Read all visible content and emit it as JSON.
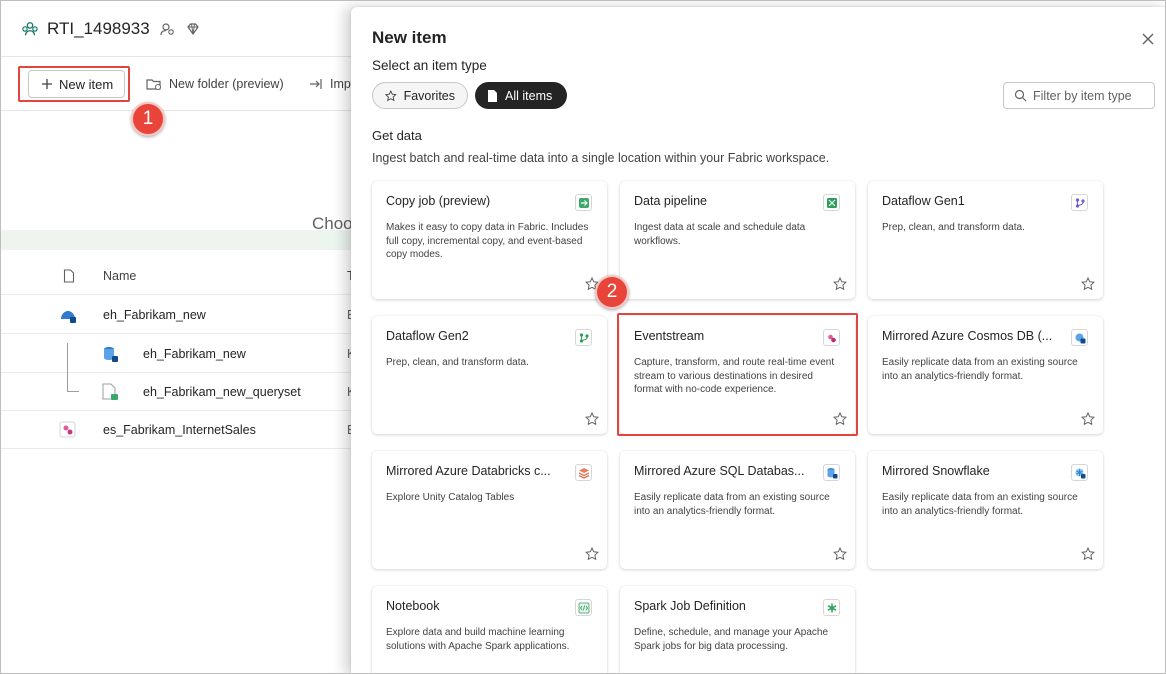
{
  "workspace": {
    "title": "RTI_1498933",
    "toolbar": {
      "new_item": "New item",
      "new_folder": "New folder (preview)",
      "import": "Imp"
    },
    "choose_text": "Choo",
    "table": {
      "col_name": "Name",
      "col_type": "T",
      "rows": [
        {
          "name": "eh_Fabrikam_new",
          "type": "E"
        },
        {
          "name": "eh_Fabrikam_new",
          "type": "K"
        },
        {
          "name": "eh_Fabrikam_new_queryset",
          "type": "K"
        },
        {
          "name": "es_Fabrikam_InternetSales",
          "type": "E"
        }
      ]
    }
  },
  "callouts": {
    "one": "1",
    "two": "2"
  },
  "panel": {
    "title": "New item",
    "subtitle": "Select an item type",
    "pill_favorites": "Favorites",
    "pill_all": "All items",
    "filter_placeholder": "Filter by item type",
    "section_title": "Get data",
    "section_desc": "Ingest batch and real-time data into a single location within your Fabric workspace.",
    "cards": [
      {
        "title": "Copy job (preview)",
        "desc": "Makes it easy to copy data in Fabric. Includes full copy, incremental copy, and event-based copy modes.",
        "icon": "copy-job-icon"
      },
      {
        "title": "Data pipeline",
        "desc": "Ingest data at scale and schedule data workflows.",
        "icon": "data-pipeline-icon"
      },
      {
        "title": "Dataflow Gen1",
        "desc": "Prep, clean, and transform data.",
        "icon": "dataflow-gen1-icon"
      },
      {
        "title": "Dataflow Gen2",
        "desc": "Prep, clean, and transform data.",
        "icon": "dataflow-gen2-icon"
      },
      {
        "title": "Eventstream",
        "desc": "Capture, transform, and route real-time event stream to various destinations in desired format with no-code experience.",
        "icon": "eventstream-icon"
      },
      {
        "title": "Mirrored Azure Cosmos DB (...",
        "desc": "Easily replicate data from an existing source into an analytics-friendly format.",
        "icon": "mirrored-cosmos-icon"
      },
      {
        "title": "Mirrored Azure Databricks c...",
        "desc": "Explore Unity Catalog Tables",
        "icon": "mirrored-databricks-icon"
      },
      {
        "title": "Mirrored Azure SQL Databas...",
        "desc": "Easily replicate data from an existing source into an analytics-friendly format.",
        "icon": "mirrored-sql-icon"
      },
      {
        "title": "Mirrored Snowflake",
        "desc": "Easily replicate data from an existing source into an analytics-friendly format.",
        "icon": "mirrored-snowflake-icon"
      },
      {
        "title": "Notebook",
        "desc": "Explore data and build machine learning solutions with Apache Spark applications.",
        "icon": "notebook-icon"
      },
      {
        "title": "Spark Job Definition",
        "desc": "Define, schedule, and manage your Apache Spark jobs for big data processing.",
        "icon": "spark-job-icon"
      }
    ]
  },
  "colors": {
    "accent_red": "#e0453f",
    "dark_pill": "#242424",
    "fabric_green": "#117865"
  }
}
